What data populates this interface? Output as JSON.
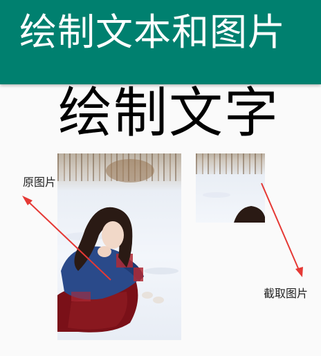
{
  "app_bar": {
    "title": "绘制文本和图片",
    "color": "#00806f"
  },
  "canvas": {
    "drawn_text": "绘制文字",
    "original_label": "原图片",
    "cropped_label": "截取图片",
    "arrow_color": "#e53935"
  }
}
